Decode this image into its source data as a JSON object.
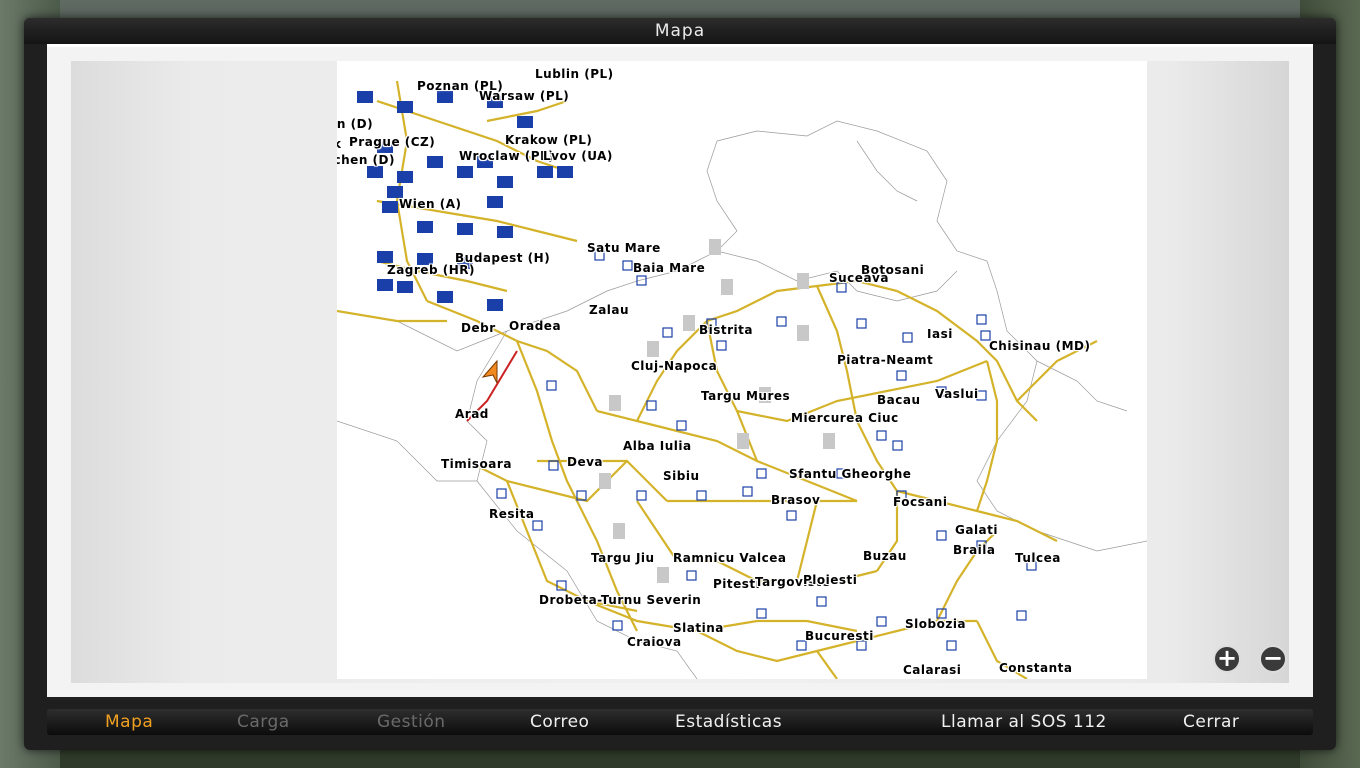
{
  "window": {
    "title": "Mapa"
  },
  "map": {
    "cities": [
      {
        "label": "Lublin (PL)"
      },
      {
        "label": "Poznan (PL)"
      },
      {
        "label": "Warsaw (PL)"
      },
      {
        "label": "Berlin (D)"
      },
      {
        "label": "Frank"
      },
      {
        "label": "Prague (CZ)"
      },
      {
        "label": "Krakow (PL)"
      },
      {
        "label": "Munchen (D)"
      },
      {
        "label": "Wroclaw (PL)"
      },
      {
        "label": "Lvov (UA)"
      },
      {
        "label": "Wien (A)"
      },
      {
        "label": "Budapest (H)"
      },
      {
        "label": "Zagreb (HR)"
      },
      {
        "label": "Satu Mare"
      },
      {
        "label": "Baia Mare"
      },
      {
        "label": "Botosani"
      },
      {
        "label": "Suceava"
      },
      {
        "label": "Zalau"
      },
      {
        "label": "Debr"
      },
      {
        "label": "Oradea"
      },
      {
        "label": "Bistrita"
      },
      {
        "label": "Iasi"
      },
      {
        "label": "Chisinau (MD)"
      },
      {
        "label": "Piatra-Neamt"
      },
      {
        "label": "Cluj-Napoca"
      },
      {
        "label": "Targu Mures"
      },
      {
        "label": "Vaslui"
      },
      {
        "label": "Bacau"
      },
      {
        "label": "Arad"
      },
      {
        "label": "Miercurea Ciuc"
      },
      {
        "label": "Alba Iulia"
      },
      {
        "label": "Timisoara"
      },
      {
        "label": "Deva"
      },
      {
        "label": "Sibiu"
      },
      {
        "label": "Sfantu Gheorghe"
      },
      {
        "label": "Brasov"
      },
      {
        "label": "Focsani"
      },
      {
        "label": "Resita"
      },
      {
        "label": "Galati"
      },
      {
        "label": "Braila"
      },
      {
        "label": "Targu Jiu"
      },
      {
        "label": "Ramnicu Valcea"
      },
      {
        "label": "Buzau"
      },
      {
        "label": "Tulcea"
      },
      {
        "label": "Pitesti"
      },
      {
        "label": "Targoviste"
      },
      {
        "label": "Ploiesti"
      },
      {
        "label": "Drobeta-Turnu Severin"
      },
      {
        "label": "Slatina"
      },
      {
        "label": "Bucuresti"
      },
      {
        "label": "Slobozia"
      },
      {
        "label": "Craiova"
      },
      {
        "label": "Calarasi"
      },
      {
        "label": "Constanta"
      }
    ]
  },
  "zoom": {
    "in": "+",
    "out": "−"
  },
  "menu": {
    "mapa": "Mapa",
    "carga": "Carga",
    "gestion": "Gestión",
    "correo": "Correo",
    "estadisticas": "Estadísticas",
    "sos": "Llamar al SOS 112",
    "cerrar": "Cerrar"
  },
  "colors": {
    "active": "#f0a020",
    "road": "#d4b32a",
    "marker": "#1a3fa8"
  }
}
